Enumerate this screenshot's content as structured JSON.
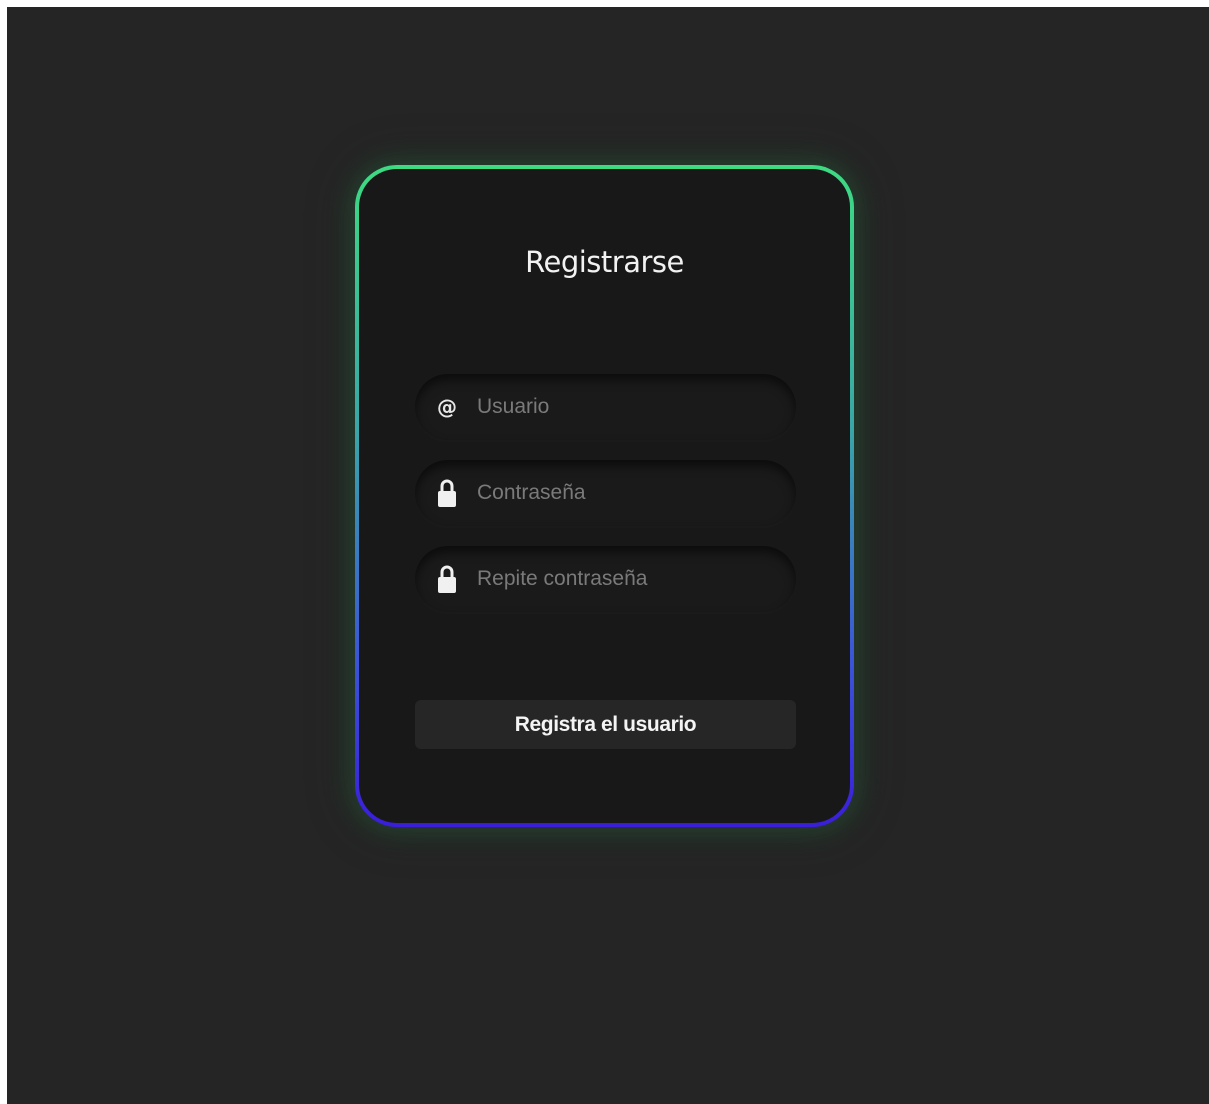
{
  "form": {
    "title": "Registrarse",
    "fields": [
      {
        "icon": "at-icon",
        "value": "",
        "placeholder": "Usuario"
      },
      {
        "icon": "lock-icon",
        "value": "",
        "placeholder": "Contraseña"
      },
      {
        "icon": "lock-icon",
        "value": "",
        "placeholder": "Repite contraseña"
      }
    ],
    "submit_label": "Registra el usuario",
    "at_symbol": "@"
  },
  "colors": {
    "background": "#252525",
    "card": "#181818",
    "border_top": "#3ddb82",
    "border_bottom": "#3a1ed8",
    "button": "#262626"
  }
}
